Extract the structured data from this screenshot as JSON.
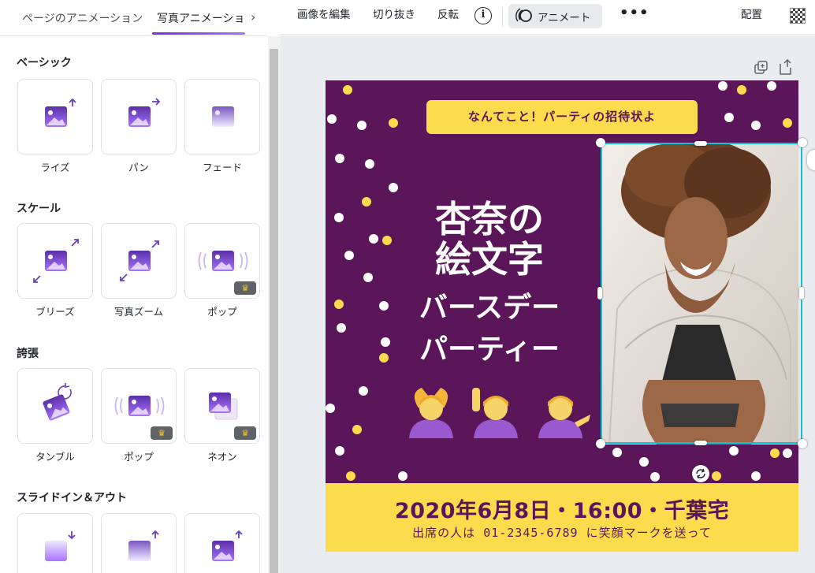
{
  "panel": {
    "tabs": [
      {
        "label": "ページのアニメーション",
        "active": false
      },
      {
        "label": "写真アニメーション",
        "active": true
      }
    ],
    "next_icon": "chevron-right-icon",
    "sections": [
      {
        "title": "ベーシック",
        "items": [
          {
            "label": "ライズ",
            "icon": "rise-icon",
            "pro": false
          },
          {
            "label": "パン",
            "icon": "pan-icon",
            "pro": false
          },
          {
            "label": "フェード",
            "icon": "fade-icon",
            "pro": false
          }
        ]
      },
      {
        "title": "スケール",
        "items": [
          {
            "label": "ブリーズ",
            "icon": "breathe-icon",
            "pro": false
          },
          {
            "label": "写真ズーム",
            "icon": "photo-zoom-icon",
            "pro": false
          },
          {
            "label": "ポップ",
            "icon": "pop-icon",
            "pro": true
          }
        ]
      },
      {
        "title": "誇張",
        "items": [
          {
            "label": "タンブル",
            "icon": "tumble-icon",
            "pro": false
          },
          {
            "label": "ポップ",
            "icon": "pop-icon",
            "pro": true
          },
          {
            "label": "ネオン",
            "icon": "neon-icon",
            "pro": true
          }
        ]
      },
      {
        "title": "スライドイン＆アウト",
        "items": [
          {
            "icon": "slide-down-icon",
            "pro": false
          },
          {
            "icon": "slide-up-fade-icon",
            "pro": false
          },
          {
            "icon": "slide-up-icon",
            "pro": false
          }
        ]
      }
    ]
  },
  "toolbar": {
    "edit_image": "画像を編集",
    "crop": "切り抜き",
    "flip": "反転",
    "info_icon": "i",
    "animate": "アニメート",
    "more": "•••",
    "position": "配置"
  },
  "design": {
    "banner": "なんてこと！パーティの招待状よ",
    "title_lines": [
      "杏奈の",
      "絵文字",
      "バースデー",
      "パーティー"
    ],
    "emojis": [
      "🙆",
      "🙋",
      "💁"
    ],
    "date_line": "2020年6月8日・16:00・千葉宅",
    "contact_line": "出席の人は 01-2345-6789 に笑顔マークを送って"
  },
  "colors": {
    "accent": "#7d2ae8",
    "design_purple": "#5b1659",
    "design_yellow": "#fadc4c",
    "selection": "#13c0d3"
  }
}
